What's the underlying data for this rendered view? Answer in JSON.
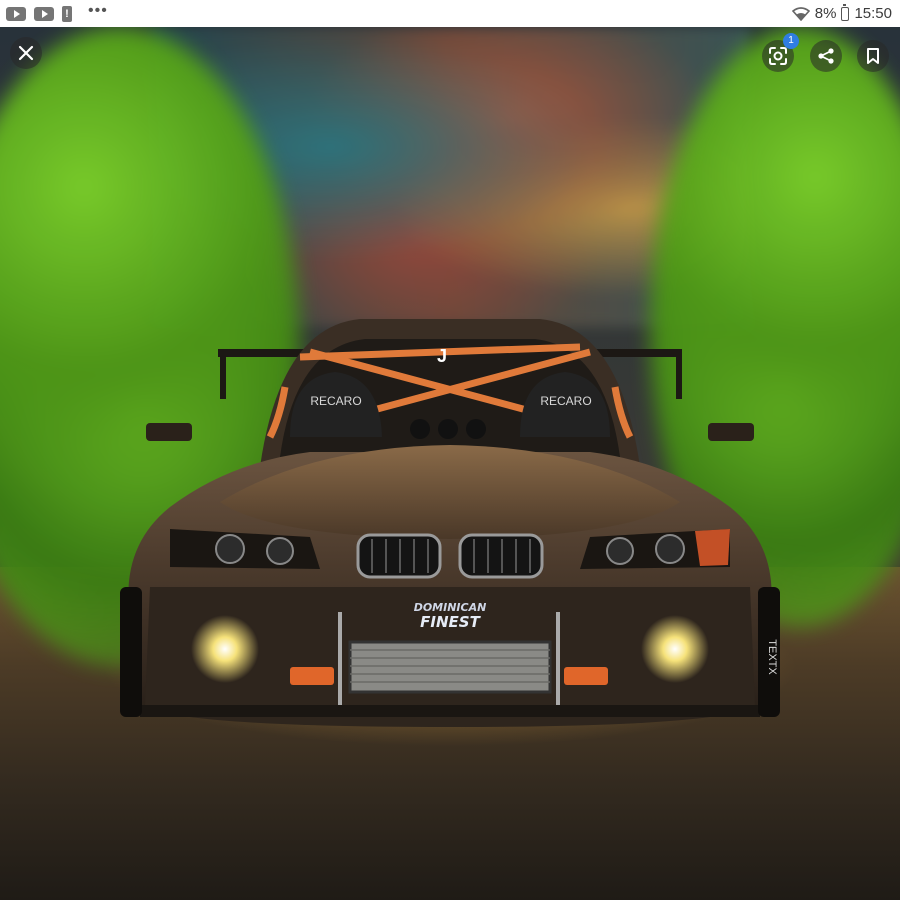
{
  "status_bar": {
    "time": "15:50",
    "battery_text": "8%",
    "left_icons": [
      "youtube-icon",
      "youtube-icon",
      "alert-icon",
      "more-dots-icon"
    ],
    "right_icons": [
      "wifi-icon",
      "battery-icon"
    ]
  },
  "viewer": {
    "lens_badge_count": "1",
    "buttons": [
      "close-icon",
      "google-lens-icon",
      "share-icon",
      "bookmark-icon"
    ]
  },
  "image": {
    "seat_brand_left": "RECARO",
    "seat_brand_right": "RECARO",
    "sponsor_line1": "DOMINICAN",
    "sponsor_line2": "FINEST",
    "cage_logo": "J",
    "tire_text": "TEXTX"
  },
  "colors": {
    "smoke": "#6bbf22",
    "badge": "#2f7de1",
    "headlight": "#f6e27a"
  }
}
